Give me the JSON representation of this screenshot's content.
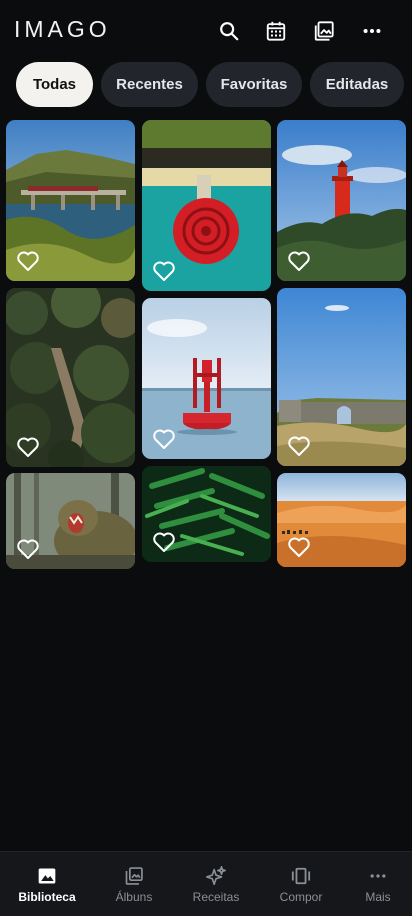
{
  "header": {
    "title": "IMAGO"
  },
  "chips": [
    {
      "label": "Todas",
      "active": true
    },
    {
      "label": "Recentes"
    },
    {
      "label": "Favoritas"
    },
    {
      "label": "Editadas"
    }
  ],
  "photos": [
    {
      "subject": "train-bridge-over-river",
      "favorite": false
    },
    {
      "subject": "red-life-ring-on-pier",
      "favorite": false
    },
    {
      "subject": "red-lighthouse",
      "favorite": false
    },
    {
      "subject": "forest-hillside",
      "favorite": false
    },
    {
      "subject": "red-buoy-at-sea",
      "favorite": false
    },
    {
      "subject": "stone-ruins-arch",
      "favorite": false
    },
    {
      "subject": "monkey-yawning",
      "favorite": false
    },
    {
      "subject": "green-fern-leaves",
      "favorite": false
    },
    {
      "subject": "desert-dunes-camels",
      "favorite": false
    }
  ],
  "bottom_nav": [
    {
      "label": "Biblioteca",
      "icon": "image-icon",
      "active": true
    },
    {
      "label": "Álbuns",
      "icon": "albums-icon"
    },
    {
      "label": "Receitas",
      "icon": "sparkle-icon"
    },
    {
      "label": "Compor",
      "icon": "carousel-icon"
    },
    {
      "label": "Mais",
      "icon": "more-horizontal-icon"
    }
  ],
  "colors": {
    "background": "#0b0c0e",
    "chip": "#22252b",
    "chip_active": "#f3f2ee",
    "nav": "#15171a"
  }
}
